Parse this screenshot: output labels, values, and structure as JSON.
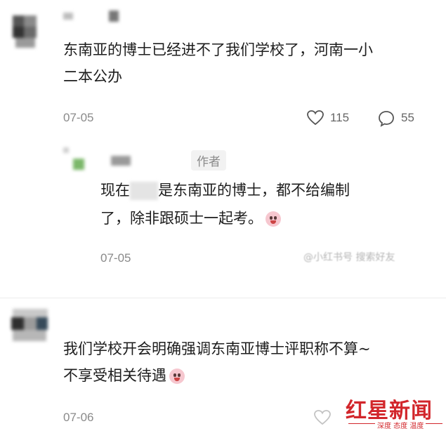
{
  "comments": [
    {
      "text_line1": "东南亚的博士已经进不了我们学校了，河南一小",
      "text_line2": "二本公办",
      "date": "07-05",
      "likes": "115",
      "replies": "55"
    },
    {
      "badge": "作者",
      "text_line1_a": "现在",
      "text_line1_b": "是东南亚的博士，都不给编制",
      "text_line2": "了，除非跟硕士一起考。",
      "date": "07-05",
      "watermark": "@小红书号 搜索好友"
    },
    {
      "text_line1": "我们学校开会明确强调东南亚博士评职称不算~",
      "text_line2": "不享受相关待遇",
      "date": "07-06"
    }
  ],
  "logo": {
    "text": "红星新闻",
    "tagline": "深度 态度 温度"
  },
  "colors": {
    "meta": "#8a8a8a",
    "logo_red": "#d2262b"
  },
  "icons": [
    "heart-icon",
    "comment-icon",
    "avatar",
    "crying-emoji-icon"
  ]
}
